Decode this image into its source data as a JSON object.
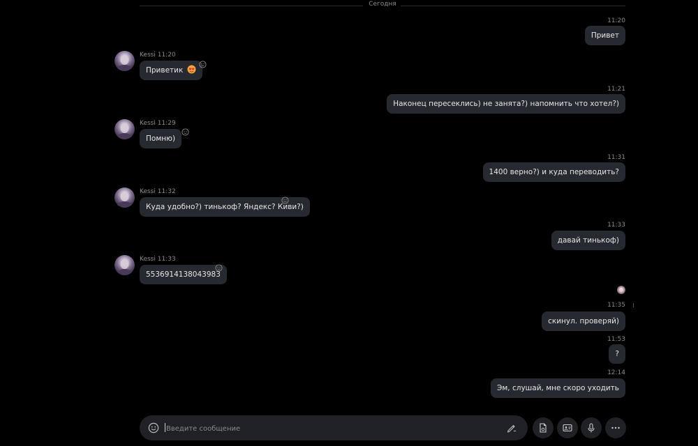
{
  "date_separator": "Сегодня",
  "messages": [
    {
      "ts": "11:20",
      "text": "Привет"
    },
    {
      "sender": "Kessi 11:20",
      "text": "Приветик"
    },
    {
      "ts": "11:21",
      "text": "Наконец пересеклись) не занята?) напомнить что хотел?)"
    },
    {
      "sender": "Kessi 11:29",
      "text": "Помню)"
    },
    {
      "ts": "11:31",
      "text": "1400 верно?) и куда переводить?"
    },
    {
      "sender": "Kessi 11:32",
      "text": "Куда удобно?) тинькоф? Яндекс? Киви?)"
    },
    {
      "ts": "11:33",
      "text": "давай тинькоф)"
    },
    {
      "sender": "Kessi 11:33",
      "text": "5536914138043983"
    },
    {
      "ts": "11:35",
      "text": "скинул. проверяй)"
    },
    {
      "ts": "11:53",
      "text": "?"
    },
    {
      "ts": "12:14",
      "text": "Эм, слушай, мне скоро уходить"
    }
  ],
  "composer": {
    "placeholder": "Введите сообщение"
  },
  "colors": {
    "background": "#000000",
    "bubble": "#26292f",
    "composer": "#1f2126",
    "meta_text": "#8a8a8a"
  },
  "icons": [
    "smile-icon",
    "pen-icon",
    "file-icon",
    "contact-card-icon",
    "microphone-icon",
    "more-icon",
    "heart-emoji-icon"
  ]
}
